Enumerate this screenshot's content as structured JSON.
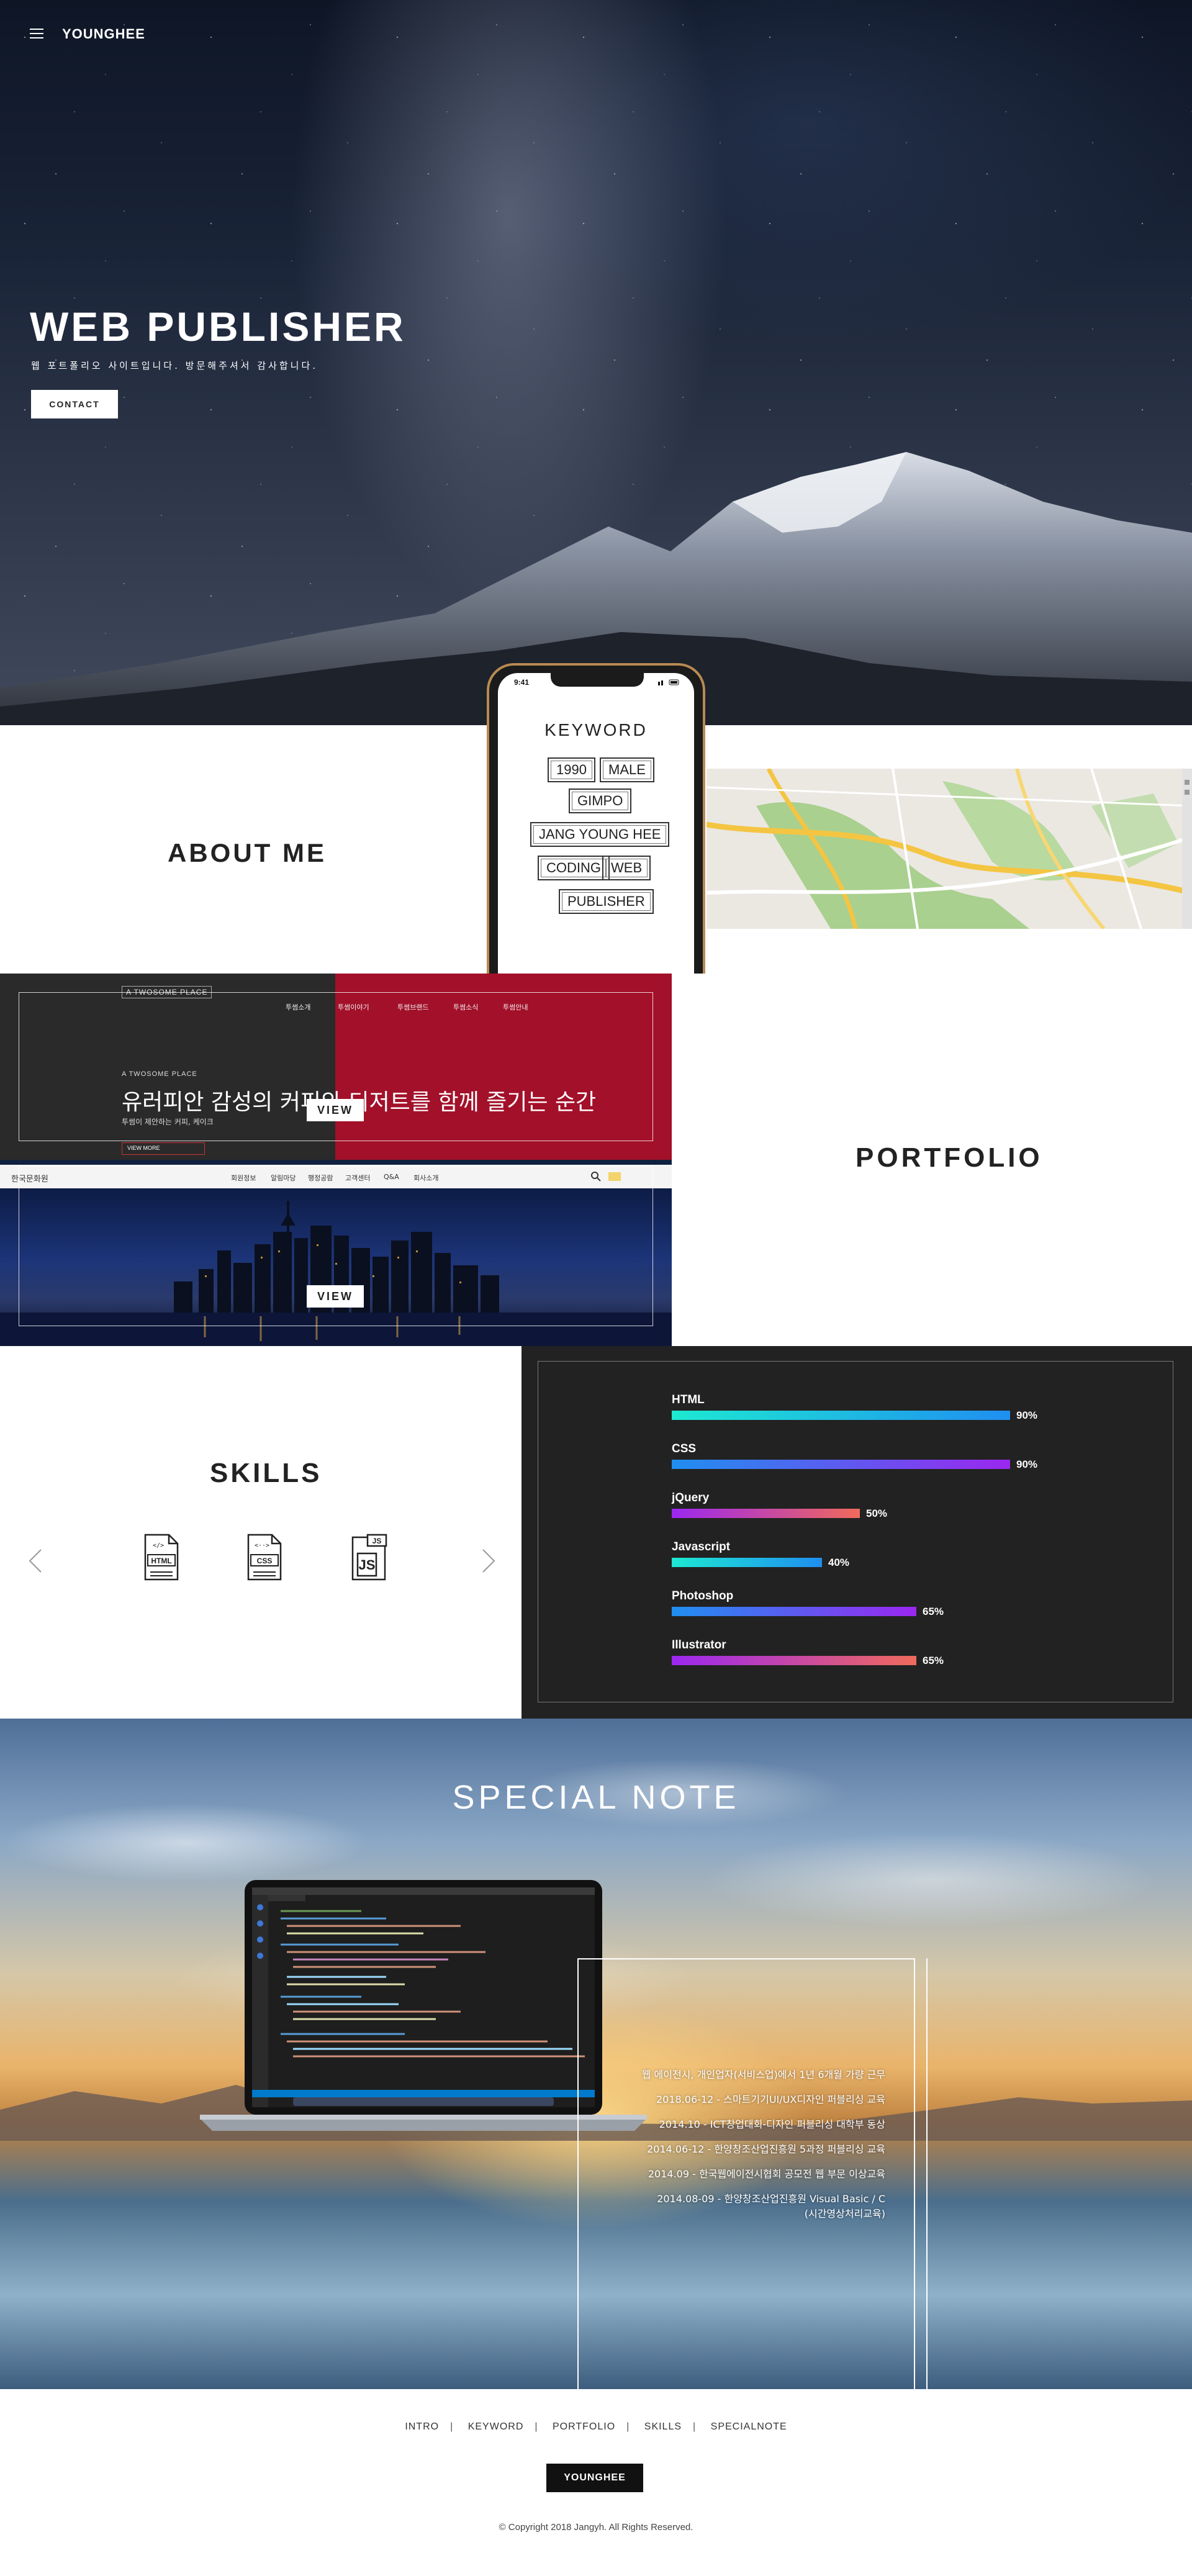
{
  "header": {
    "logo": "YOUNGHEE",
    "menu_icon": "hamburger-icon"
  },
  "hero": {
    "title": "WEB PUBLISHER",
    "subtitle": "웹 포트폴리오 사이트입니다. 방문해주셔서 감사합니다.",
    "contact_label": "CONTACT"
  },
  "about": {
    "title": "ABOUT ME"
  },
  "keyword": {
    "phone_time": "9:41",
    "title": "KEYWORD",
    "items": [
      "1990",
      "MALE",
      "GIMPO",
      "JANG YOUNG HEE",
      "CODING",
      "WEB",
      "PUBLISHER"
    ]
  },
  "portfolio": {
    "title": "PORTFOLIO",
    "view_label": "VIEW",
    "twosome": {
      "logo": "A TWOSOME PLACE",
      "nav": [
        "투썸소개",
        "투썸이야기",
        "투썸브랜드",
        "투썸소식",
        "투썸안내"
      ],
      "label": "A TWOSOME PLACE",
      "headline": "유러피안 감성의 커피와 디저트를 함께 즐기는 순간",
      "small": "투썸이 제안하는 커피, 케이크",
      "button": "VIEW MORE"
    },
    "second": {
      "brand": "한국문화원",
      "nav": [
        "회원정보",
        "알림마당",
        "행정공람",
        "고객센터",
        "Q&A",
        "회사소개"
      ]
    }
  },
  "skills": {
    "title": "SKILLS",
    "icons": [
      "html-file-icon",
      "css-file-icon",
      "js-file-icon"
    ],
    "bars": [
      {
        "name": "HTML",
        "percent": 90,
        "label": "90%",
        "from": "#1de9d2",
        "to": "#1f8ff0"
      },
      {
        "name": "CSS",
        "percent": 90,
        "label": "90%",
        "from": "#1f8ff0",
        "to": "#9b27f0"
      },
      {
        "name": "jQuery",
        "percent": 50,
        "label": "50%",
        "from": "#9b27f0",
        "to": "#f06a5b"
      },
      {
        "name": "Javascript",
        "percent": 40,
        "label": "40%",
        "from": "#1de9d2",
        "to": "#1f8ff0"
      },
      {
        "name": "Photoshop",
        "percent": 65,
        "label": "65%",
        "from": "#1f8ff0",
        "to": "#9b27f0"
      },
      {
        "name": "Illustrator",
        "percent": 65,
        "label": "65%",
        "from": "#9b27f0",
        "to": "#f06a5b"
      }
    ]
  },
  "special": {
    "title": "SPECIAL NOTE",
    "notes": [
      "웹 에이전시, 개인업자(서비스업)에서 1년 6개월 가량 근무",
      "2018.06-12 - 스마트기기UI/UX디자인 퍼블리싱 교육",
      "2014.10 - ICT창업대회-디자인 퍼블리싱 대학부 동상",
      "2014.06-12 - 한양창조산업진흥원 5과정 퍼블리싱 교육",
      "2014.09 - 한국웹에이전시협회 공모전 웹 부문 이상교육",
      "2014.08-09 - 한양창조산업진흥원 Visual Basic / C",
      "(시간영상처리교육)"
    ]
  },
  "footer": {
    "nav": [
      "INTRO",
      "KEYWORD",
      "PORTFOLIO",
      "SKILLS",
      "SPECIALNOTE"
    ],
    "logo": "YOUNGHEE",
    "copyright": "© Copyright 2018 Jangyh. All Rights Reserved."
  }
}
